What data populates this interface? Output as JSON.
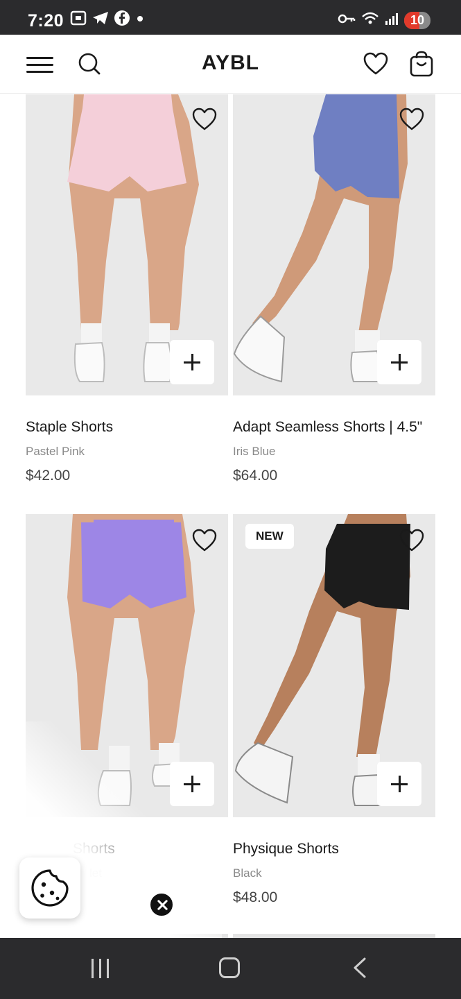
{
  "status_bar": {
    "time": "7:20",
    "battery": "10"
  },
  "header": {
    "brand": "AYBL"
  },
  "products": [
    {
      "name": "Staple Shorts",
      "color": "Pastel Pink",
      "price": "$42.00",
      "badge": "",
      "short_color": "#f4cfd9",
      "skin": "#d9a688"
    },
    {
      "name": "Adapt Seamless Shorts | 4.5\"",
      "color": "Iris Blue",
      "price": "$64.00",
      "badge": "",
      "short_color": "#6f7fc2",
      "skin": "#cf9a79"
    },
    {
      "name": "Shorts",
      "color": "let",
      "price": "",
      "badge": "",
      "short_color": "#9d86e6",
      "skin": "#d9a688"
    },
    {
      "name": "Physique Shorts",
      "color": "Black",
      "price": "$48.00",
      "badge": "NEW",
      "short_color": "#1c1c1c",
      "skin": "#b7805d"
    }
  ],
  "icons": {
    "menu": "hamburger-icon",
    "search": "search-icon",
    "wishlist": "heart-icon",
    "bag": "shopping-bag-icon",
    "add": "plus-icon",
    "cookie": "cookie-icon",
    "close": "close-icon"
  }
}
